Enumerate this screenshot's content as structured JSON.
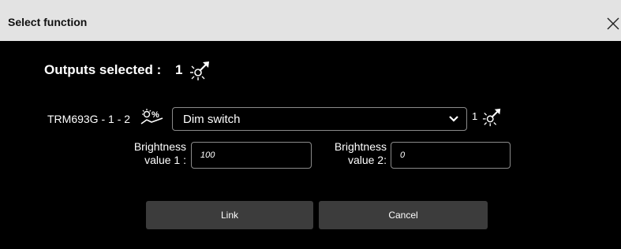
{
  "dialog": {
    "title": "Select function",
    "close_icon": "close-icon"
  },
  "outputs": {
    "label": "Outputs selected :",
    "count": "1",
    "icon": "light-output-icon"
  },
  "channel": {
    "device_label": "TRM693G - 1 - 2",
    "device_icon": "dimmer-percent-icon",
    "function_select": {
      "selected": "Dim switch",
      "chevron_icon": "chevron-down-icon"
    },
    "count": "1",
    "count_icon": "light-output-icon"
  },
  "fields": {
    "brightness1": {
      "label_line1": "Brightness",
      "label_line2": "value 1 :",
      "value": "100"
    },
    "brightness2": {
      "label_line1": "Brightness",
      "label_line2": "value 2:",
      "value": "0"
    }
  },
  "buttons": {
    "link": "Link",
    "cancel": "Cancel"
  },
  "colors": {
    "titlebar": "#e3e3e3",
    "background": "#000000",
    "button": "#3c3c3c",
    "border": "#8a8a8a",
    "text": "#ffffff"
  }
}
